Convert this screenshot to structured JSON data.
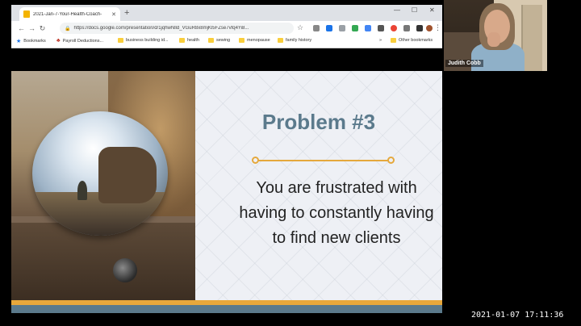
{
  "browser": {
    "tab_title": "2021-Jan-7-Your-Health-Coach-",
    "new_tab_symbol": "+",
    "url": "https://docs.google.com/presentation/d/1jqhwNlld_VGuR8x8mjKl5FZse7vfq4Yi8...",
    "bookmarks": [
      {
        "label": "Bookmarks",
        "type": "star"
      },
      {
        "label": "Payroll Deductions...",
        "type": "leaf"
      },
      {
        "label": "business building id...",
        "type": "folder"
      },
      {
        "label": "health",
        "type": "folder"
      },
      {
        "label": "sewing",
        "type": "folder"
      },
      {
        "label": "menopause",
        "type": "folder"
      },
      {
        "label": "family history",
        "type": "folder"
      }
    ],
    "more_bookmarks_symbol": "»",
    "other_bookmarks": "Other bookmarks"
  },
  "slide": {
    "title": "Problem #3",
    "body_lines": [
      "You are frustrated with",
      "having to constantly having",
      "to find new clients"
    ],
    "accent_orange": "#e8a83b",
    "accent_blue": "#5b7a8c"
  },
  "webcam": {
    "participant_name": "Judith Cobb"
  },
  "timestamp": "2021-01-07  17:11:36"
}
